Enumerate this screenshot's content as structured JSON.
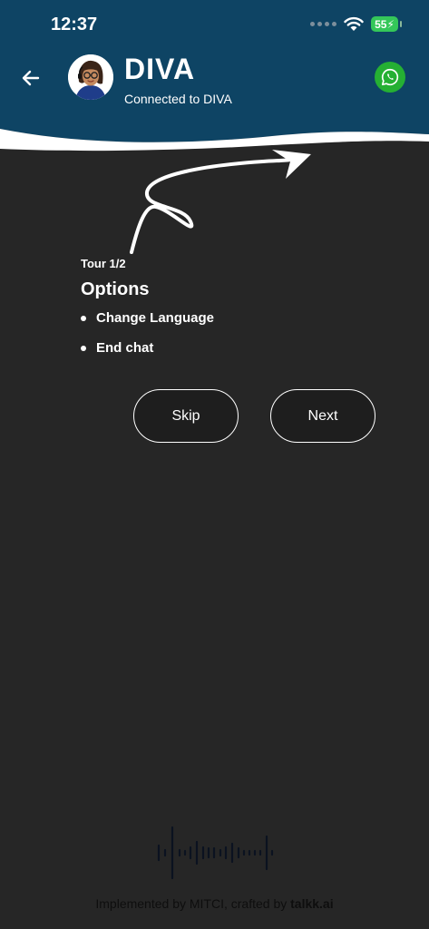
{
  "status_bar": {
    "time": "12:37",
    "battery": "55"
  },
  "header": {
    "title": "DIVA",
    "subtitle": "Connected to DIVA",
    "colors": {
      "background": "#0e4464",
      "whatsapp": "#25b033"
    }
  },
  "tour": {
    "step": "Tour 1/2",
    "title": "Options",
    "items": [
      "Change Language",
      "End chat"
    ],
    "skip_label": "Skip",
    "next_label": "Next"
  },
  "footer": {
    "prefix": "Implemented by MITCI, crafted by ",
    "brand": "talkk.ai"
  },
  "icons": [
    "back-arrow-icon",
    "avatar",
    "whatsapp-icon",
    "wifi-icon",
    "battery-icon",
    "voice-wave-icon"
  ]
}
